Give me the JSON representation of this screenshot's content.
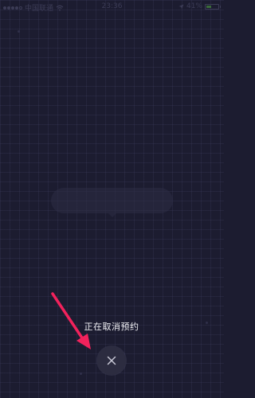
{
  "status_bar": {
    "carrier": "中国联通",
    "time": "23:36",
    "battery": "41%",
    "battery_level": 0.41
  },
  "cancel": {
    "status_text": "正在取消预约",
    "button_icon": "close-icon"
  },
  "annotation": {
    "arrow_color": "#f2225c"
  }
}
